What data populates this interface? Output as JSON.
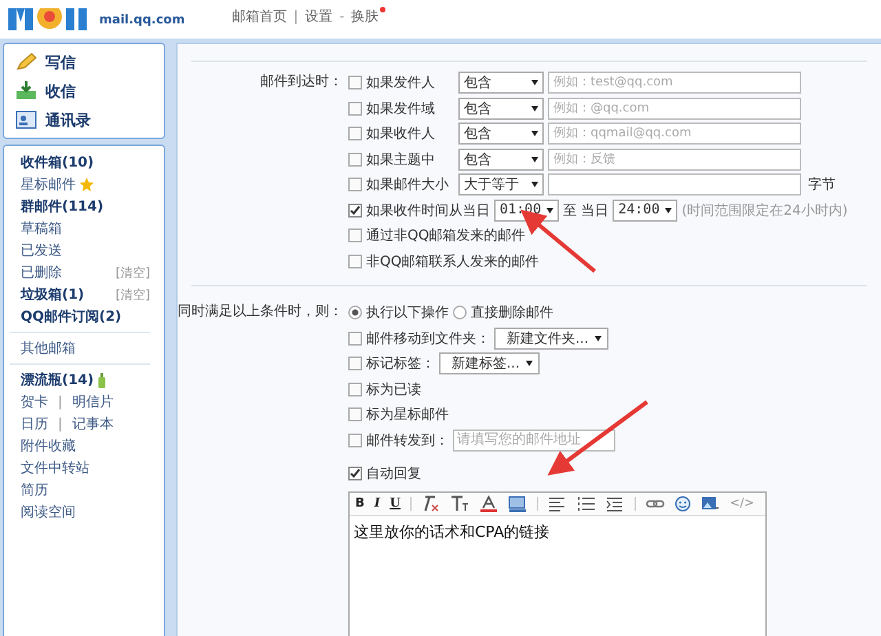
{
  "header": {
    "logo_text": "mail.qq.com",
    "nav": [
      {
        "label": "邮箱首页"
      },
      {
        "sep": "|",
        "label": "设置"
      },
      {
        "sep": "-",
        "label": "换肤",
        "dot": true
      }
    ]
  },
  "sidebar": {
    "actions": [
      {
        "kind": "compose",
        "label": "写信"
      },
      {
        "kind": "receive",
        "label": "收信"
      },
      {
        "kind": "contacts",
        "label": "通讯录"
      }
    ],
    "groups": [
      [
        {
          "kind": "plain",
          "label": "收件箱(10)",
          "bold": true
        },
        {
          "kind": "star",
          "label": "星标邮件",
          "bold": false
        },
        {
          "kind": "plain",
          "label": "群邮件(114)",
          "bold": true
        },
        {
          "kind": "plain",
          "label": "草稿箱",
          "bold": false
        },
        {
          "kind": "plain",
          "label": "已发送",
          "bold": false
        },
        {
          "kind": "plain",
          "label": "已删除",
          "bold": false,
          "action": "[清空]"
        },
        {
          "kind": "plain",
          "label": "垃圾箱(1)",
          "bold": true,
          "action": "[清空]"
        },
        {
          "kind": "plain",
          "label": "QQ邮件订阅(2)",
          "bold": true
        }
      ],
      [
        {
          "kind": "plain",
          "label": "其他邮箱",
          "bold": false
        }
      ],
      [
        {
          "kind": "bottle",
          "label": "漂流瓶(14)",
          "bold": true
        },
        {
          "kind": "pair",
          "links": [
            "贺卡",
            "明信片"
          ],
          "separator": "|",
          "bold": false
        },
        {
          "kind": "pair",
          "links": [
            "日历",
            "记事本"
          ],
          "separator": "|",
          "bold": false
        },
        {
          "kind": "plain",
          "label": "附件收藏",
          "bold": false
        },
        {
          "kind": "plain",
          "label": "文件中转站",
          "bold": false
        },
        {
          "kind": "plain",
          "label": "简历",
          "bold": false
        },
        {
          "kind": "plain",
          "label": "阅读空间",
          "bold": false
        }
      ]
    ]
  },
  "conditions": {
    "label": "邮件到达时：",
    "rows": [
      {
        "kind": "match",
        "checked": false,
        "label": "如果发件人",
        "operator": "包含",
        "placeholder": "例如：test@qq.com"
      },
      {
        "kind": "match",
        "checked": false,
        "label": "如果发件域",
        "operator": "包含",
        "placeholder": "例如：@qq.com"
      },
      {
        "kind": "match",
        "checked": false,
        "label": "如果收件人",
        "operator": "包含",
        "placeholder": "例如：qqmail@qq.com"
      },
      {
        "kind": "match",
        "checked": false,
        "label": "如果主题中",
        "operator": "包含",
        "placeholder": "例如：反馈"
      },
      {
        "kind": "size",
        "checked": false,
        "label": "如果邮件大小",
        "operator": "大于等于",
        "unit": "字节"
      },
      {
        "kind": "time",
        "checked": true,
        "label": "如果收件时间从当日",
        "from": "01:00",
        "to_label": "至",
        "to_prefix": "当日",
        "to": "24:00",
        "note": "(时间范围限定在24小时内)"
      },
      {
        "kind": "plain",
        "checked": false,
        "label": "通过非QQ邮箱发来的邮件"
      },
      {
        "kind": "plain",
        "checked": false,
        "label": "非QQ邮箱联系人发来的邮件"
      }
    ]
  },
  "actions": {
    "label": "同时满足以上条件时，则：",
    "radios": [
      {
        "label": "执行以下操作",
        "selected": true
      },
      {
        "label": "直接删除邮件",
        "selected": false
      }
    ],
    "rows": [
      {
        "kind": "select",
        "checked": false,
        "label": "邮件移动到文件夹：",
        "value": "新建文件夹..."
      },
      {
        "kind": "select",
        "checked": false,
        "label": "标记标签：",
        "value": "新建标签..."
      },
      {
        "kind": "plain",
        "checked": false,
        "label": "标为已读"
      },
      {
        "kind": "plain",
        "checked": false,
        "label": "标为星标邮件"
      },
      {
        "kind": "input",
        "checked": false,
        "label": "邮件转发到：",
        "placeholder": "请填写您的邮件地址"
      },
      {
        "kind": "plain",
        "checked": true,
        "label": "自动回复"
      }
    ],
    "editor": {
      "toolbar": [
        {
          "kind": "text",
          "label": "B"
        },
        {
          "kind": "text",
          "label": "I"
        },
        {
          "kind": "text",
          "label": "U"
        },
        {
          "kind": "sep"
        },
        {
          "kind": "eraser"
        },
        {
          "kind": "font-size"
        },
        {
          "kind": "font-color"
        },
        {
          "kind": "bg-color"
        },
        {
          "kind": "sep"
        },
        {
          "kind": "align"
        },
        {
          "kind": "list"
        },
        {
          "kind": "indent"
        },
        {
          "kind": "sep"
        },
        {
          "kind": "link"
        },
        {
          "kind": "emoji"
        },
        {
          "kind": "image"
        },
        {
          "kind": "text",
          "label": "</>"
        }
      ],
      "content": "这里放你的话术和CPA的链接"
    }
  }
}
